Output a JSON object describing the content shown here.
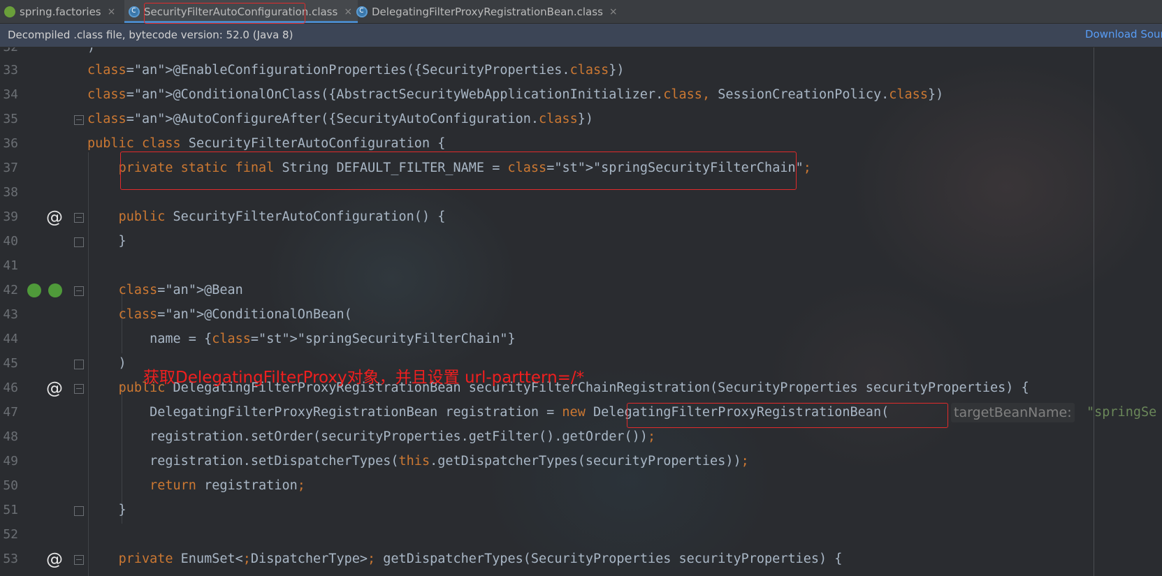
{
  "tabs": [
    {
      "label": "spring.factories",
      "icon": "spring-leaf-icon",
      "close": "×"
    },
    {
      "label": "SecurityFilterAutoConfiguration.class",
      "icon": "class-file-icon",
      "close": "×",
      "active": true
    },
    {
      "label": "DelegatingFilterProxyRegistrationBean.class",
      "icon": "class-file-icon",
      "close": "×"
    }
  ],
  "notice": {
    "text": "Decompiled .class file, bytecode version: 52.0 (Java 8)",
    "link": "Download Sour"
  },
  "code_lines": [
    {
      "n": "32",
      "code": ")"
    },
    {
      "n": "33",
      "code": "@EnableConfigurationProperties({SecurityProperties.class})"
    },
    {
      "n": "34",
      "code": "@ConditionalOnClass({AbstractSecurityWebApplicationInitializer.class, SessionCreationPolicy.class})"
    },
    {
      "n": "35",
      "code": "@AutoConfigureAfter({SecurityAutoConfiguration.class})"
    },
    {
      "n": "36",
      "code": "public class SecurityFilterAutoConfiguration {"
    },
    {
      "n": "37",
      "code": "    private static final String DEFAULT_FILTER_NAME = \"springSecurityFilterChain\";"
    },
    {
      "n": "38",
      "code": ""
    },
    {
      "n": "39",
      "code": "    public SecurityFilterAutoConfiguration() {"
    },
    {
      "n": "40",
      "code": "    }"
    },
    {
      "n": "41",
      "code": ""
    },
    {
      "n": "42",
      "code": "    @Bean"
    },
    {
      "n": "43",
      "code": "    @ConditionalOnBean("
    },
    {
      "n": "44",
      "code": "        name = {\"springSecurityFilterChain\"}"
    },
    {
      "n": "45",
      "code": "    )"
    },
    {
      "n": "46",
      "code": "    public DelegatingFilterProxyRegistrationBean securityFilterChainRegistration(SecurityProperties securityProperties) {"
    },
    {
      "n": "47",
      "code": "        DelegatingFilterProxyRegistrationBean registration = new DelegatingFilterProxyRegistrationBean("
    },
    {
      "n": "48",
      "code": "        registration.setOrder(securityProperties.getFilter().getOrder());"
    },
    {
      "n": "49",
      "code": "        registration.setDispatcherTypes(this.getDispatcherTypes(securityProperties));"
    },
    {
      "n": "50",
      "code": "        return registration;"
    },
    {
      "n": "51",
      "code": "    }"
    },
    {
      "n": "52",
      "code": ""
    },
    {
      "n": "53",
      "code": "    private EnumSet<DispatcherType> getDispatcherTypes(SecurityProperties securityProperties) {"
    }
  ],
  "inlay_hint": {
    "label": "targetBeanName:",
    "value": "\"springSe"
  },
  "annotation": "获取DelegatingFilterProxy对象，并且设置 url-parttern=/*",
  "gutter_icons": {
    "at": "@"
  },
  "colors": {
    "keyword": "#cc7832",
    "annotation": "#bbb529",
    "string": "#6a8759",
    "text": "#a9b7c6",
    "highlight_box": "#e22b2b",
    "link": "#589df6"
  }
}
